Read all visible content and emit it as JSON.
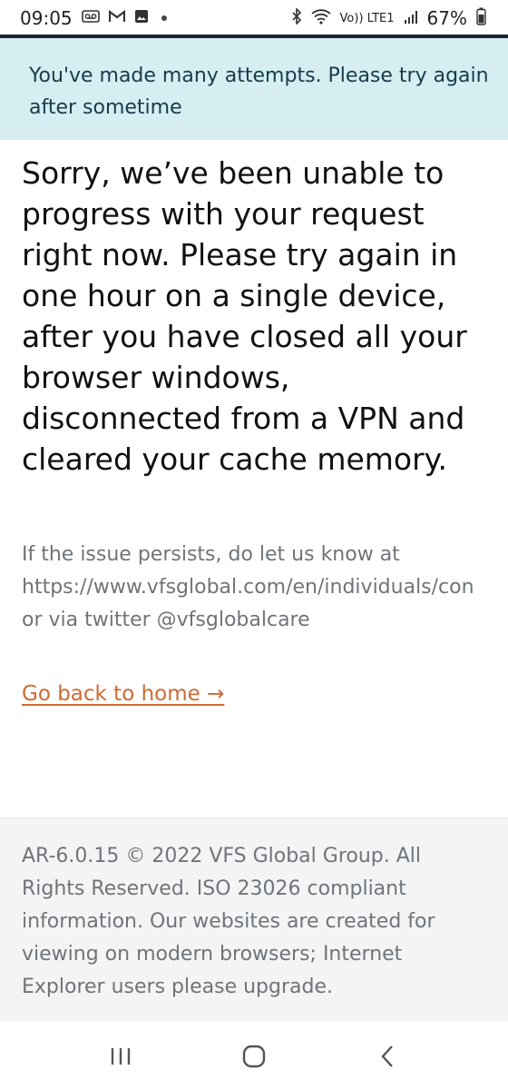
{
  "status_bar": {
    "time": "09:05",
    "notification_icons": [
      "voicemail-icon",
      "gmail-icon",
      "gallery-icon"
    ],
    "right_icons": [
      "bluetooth-icon",
      "wifi-icon",
      "volte-icon",
      "signal-icon"
    ],
    "volte_label": "Vo)) LTE1",
    "battery": "67%"
  },
  "alert": {
    "line1": "You've made many attempts. Please try again",
    "line2": "after sometime"
  },
  "main": {
    "message": "Sorry, we’ve been unable to progress with your request right now. Please try again in one hour on a single device, after you have closed all your browser windows, disconnected from a VPN and cleared your cache memory.",
    "help_line1": "If the issue persists, do let us know at",
    "help_line2": "https://www.vfsglobal.com/en/individuals/con",
    "help_line3": "or via twitter @vfsglobalcare",
    "home_link": "Go back to home →"
  },
  "footer": {
    "text": "AR-6.0.15 © 2022 VFS Global Group. All Rights Reserved. ISO 23026 compliant information. Our websites are created for viewing on modern browsers; Internet Explorer users please upgrade."
  },
  "nav": {
    "icons": [
      "recent-apps-icon",
      "home-icon",
      "back-icon"
    ]
  },
  "colors": {
    "alert_bg": "#d6edf1",
    "alert_text": "#173b4d",
    "link": "#cf6a31",
    "footer_bg": "#f3f4f5"
  }
}
